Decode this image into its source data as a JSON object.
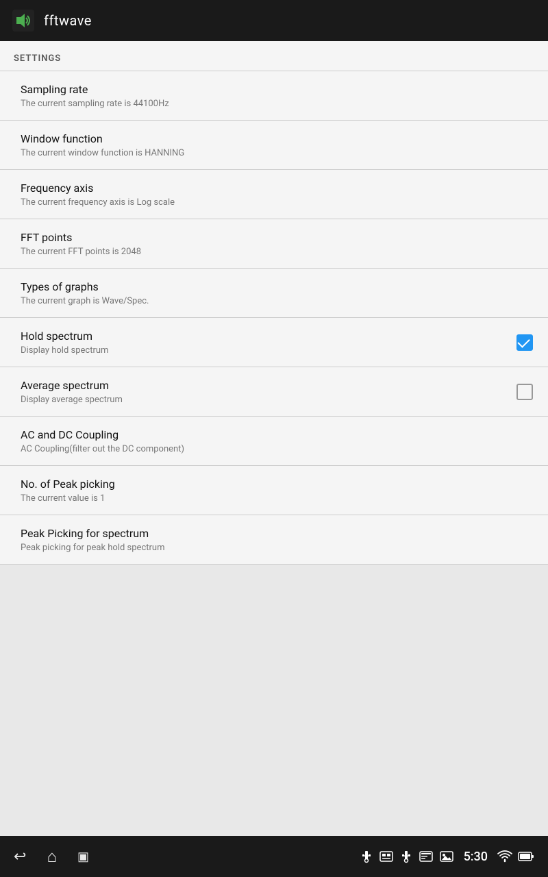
{
  "appBar": {
    "title": "fftwave",
    "iconLabel": "fftwave-app-icon"
  },
  "settings": {
    "sectionHeader": "SETTINGS",
    "items": [
      {
        "id": "sampling-rate",
        "title": "Sampling rate",
        "subtitle": "The current sampling rate is 44100Hz",
        "hasControl": false,
        "controlType": null
      },
      {
        "id": "window-function",
        "title": "Window function",
        "subtitle": "The current window function is HANNING",
        "hasControl": false,
        "controlType": null
      },
      {
        "id": "frequency-axis",
        "title": "Frequency axis",
        "subtitle": "The current frequency axis is Log scale",
        "hasControl": false,
        "controlType": null
      },
      {
        "id": "fft-points",
        "title": "FFT points",
        "subtitle": "The current FFT points is 2048",
        "hasControl": false,
        "controlType": null
      },
      {
        "id": "types-of-graphs",
        "title": "Types of graphs",
        "subtitle": "The current graph is Wave/Spec.",
        "hasControl": false,
        "controlType": null
      },
      {
        "id": "hold-spectrum",
        "title": "Hold spectrum",
        "subtitle": "Display hold spectrum",
        "hasControl": true,
        "controlType": "checkbox",
        "checked": true
      },
      {
        "id": "average-spectrum",
        "title": "Average spectrum",
        "subtitle": "Display average spectrum",
        "hasControl": true,
        "controlType": "checkbox",
        "checked": false
      },
      {
        "id": "ac-dc-coupling",
        "title": "AC and DC Coupling",
        "subtitle": "AC Coupling(filter out the DC component)",
        "hasControl": false,
        "controlType": null
      },
      {
        "id": "peak-picking-no",
        "title": "No. of Peak picking",
        "subtitle": "The current value is 1",
        "hasControl": false,
        "controlType": null
      },
      {
        "id": "peak-picking-spectrum",
        "title": "Peak Picking for spectrum",
        "subtitle": "Peak picking for peak hold spectrum",
        "hasControl": false,
        "controlType": null
      }
    ]
  },
  "navBar": {
    "time": "5:30",
    "backLabel": "Back",
    "homeLabel": "Home",
    "recentsLabel": "Recents"
  },
  "statusIcons": {
    "usb1": "USB",
    "usb2": "USB",
    "news": "NEWS",
    "image": "IMG",
    "wifi": "WiFi",
    "battery": "Battery"
  }
}
